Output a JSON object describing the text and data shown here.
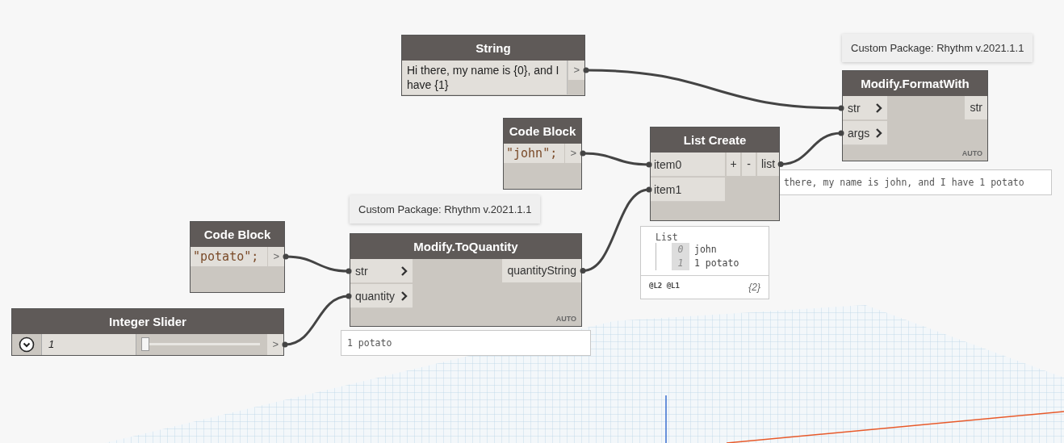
{
  "tooltips": [
    {
      "text": "Custom Package: Rhythm v.2021.1.1"
    },
    {
      "text": "Custom Package: Rhythm v.2021.1.1"
    }
  ],
  "nodes": [
    {
      "kind": "string",
      "title": "String",
      "value": "Hi there, my name is {0}, and I have {1}",
      "outputs": [
        ">"
      ]
    },
    {
      "kind": "code",
      "title": "Code Block",
      "code": "\"john\";",
      "outputs": [
        ">"
      ]
    },
    {
      "kind": "list_create",
      "title": "List Create",
      "inputs": [
        "item0",
        "item1"
      ],
      "buttons": [
        "+",
        "-"
      ],
      "outputs": [
        "list"
      ]
    },
    {
      "kind": "function",
      "title": "Modify.FormatWith",
      "inputs": [
        "str",
        "args"
      ],
      "outputs": [
        "str"
      ],
      "lacing": "AUTO"
    },
    {
      "kind": "code",
      "title": "Code Block",
      "code": "\"potato\";",
      "outputs": [
        ">"
      ]
    },
    {
      "kind": "function",
      "title": "Modify.ToQuantity",
      "inputs": [
        "str",
        "quantity"
      ],
      "outputs": [
        "quantityString"
      ],
      "lacing": "AUTO"
    },
    {
      "kind": "slider",
      "title": "Integer Slider",
      "value": "1",
      "level": 0.0,
      "outputs": [
        ">"
      ]
    }
  ],
  "previews": [
    {
      "kind": "text",
      "text": "there, my name is john, and I have 1 potato"
    },
    {
      "kind": "text",
      "text": "1 potato"
    },
    {
      "kind": "list",
      "title": "List",
      "items": [
        {
          "index": "0",
          "value": "john"
        },
        {
          "index": "1",
          "value": "1 potato"
        }
      ],
      "levels": "@L2 @L1",
      "count": "{2}"
    }
  ]
}
